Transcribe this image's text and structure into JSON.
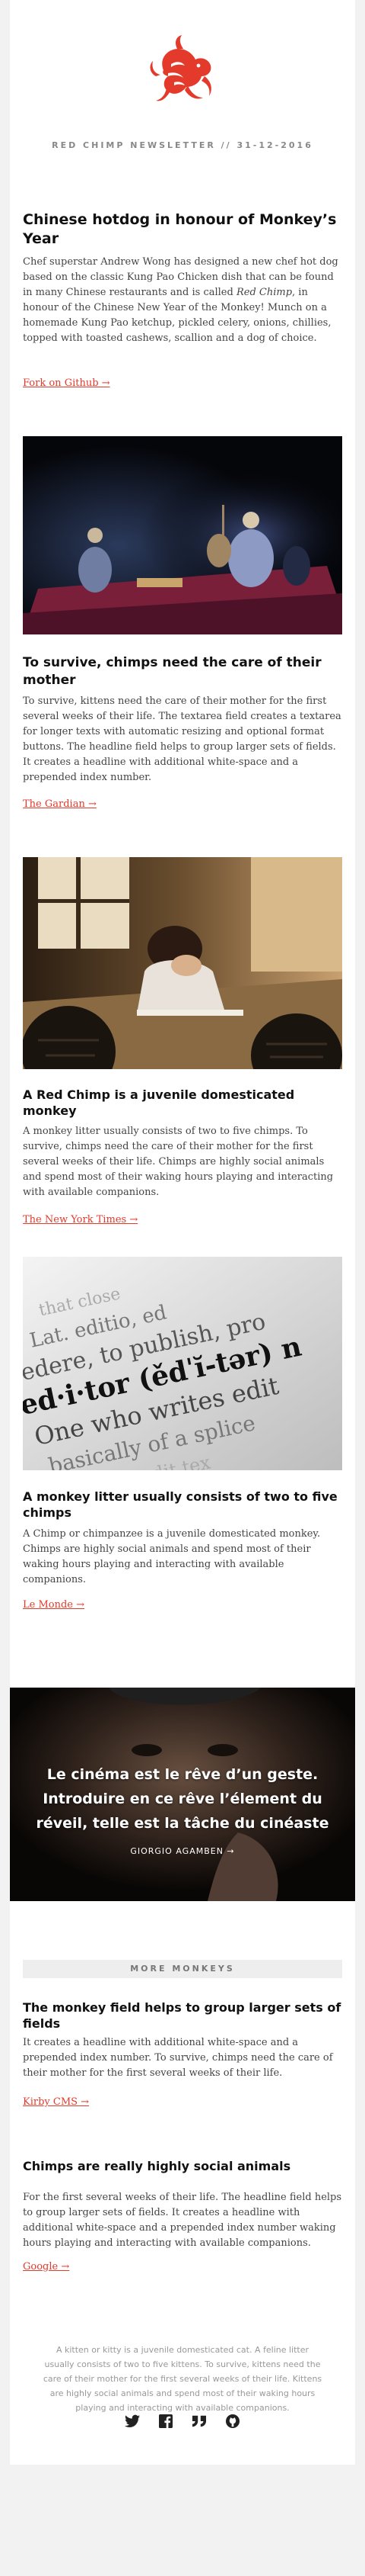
{
  "header": {
    "newsletter": "RED CHIMP NEWSLETTER // 31-12-2016"
  },
  "article1": {
    "title": "Chinese hotdog in honour of Monkey’s Year",
    "body_before": "Chef superstar Andrew Wong has designed a new chef hot dog based on the classic Kung Pao Chicken dish that can be found in many Chinese restaurants and is called ",
    "body_em": "Red Chimp",
    "body_after": ", in honour of the Chinese New Year of the Monkey! Munch on a homemade Kung Pao ketchup, pickled celery, onions, chillies, topped with toasted cashews, scallion and a dog of choice.",
    "link": "Fork on Github →"
  },
  "article2": {
    "title": "To survive, chimps need the care of their mother",
    "body": "To survive, kittens need the care of their mother for the first several weeks of their life. The textarea field creates a textarea for longer texts with automatic resizing and optional format buttons. The headline field helps to group larger sets of fields. It creates a headline with additional white-space and a prepended index number.",
    "link": "The Gardian →"
  },
  "article3": {
    "title": "A Red Chimp is a juvenile domesticated monkey",
    "body": "A monkey litter usually consists of two to five chimps. To survive, chimps need the care of their mother for the first several weeks of their life. Chimps are highly social animals and spend most of their waking hours playing and interacting with available companions.",
    "link": "The New York Times →"
  },
  "article4": {
    "image_words": [
      "that close",
      "Lat. editio, ed",
      "edere, to publish, pro",
      "ed·i·tor (ědˈĭ-tər) n",
      "One who writes edit",
      "basically of a splice",
      "used to edit tex"
    ],
    "title": "A monkey litter usually consists of two to five chimps",
    "body": "A Chimp or chimpanzee is a juvenile domesticated monkey. Chimps are highly social animals and spend most of their waking hours playing and interacting with available companions.",
    "link": "Le Monde →"
  },
  "quote": {
    "text": "Le cinéma est le rêve d’un geste. Introduire en ce rêve l’élement du réveil, telle est la tâche du cinéaste",
    "author": "GIORGIO AGAMBEN →"
  },
  "more": {
    "label": "MORE MONKEYS"
  },
  "more1": {
    "title": "The monkey field helps to group larger sets of fields",
    "body": "It creates a headline with additional white-space and a prepended index number. To survive, chimps need the care of their mother for the first several weeks of their life.",
    "link": "Kirby CMS →"
  },
  "more2": {
    "title": "Chimps are really highly social animals",
    "body": "For the first several weeks of their life. The headline field helps to group larger sets of fields. It creates a headline with additional white-space and a prepended index number waking hours playing and interacting with available companions.",
    "link": "Google →"
  },
  "footer": {
    "text": "A kitten or kitty is a juvenile domesticated cat. A feline litter usually consists of two to five kittens. To survive, kittens need the care of their mother for the first several weeks of their life. Kittens are highly social animals and spend most of their waking hours playing and interacting with available companions."
  },
  "social": [
    "twitter-icon",
    "facebook-icon",
    "quote-icon",
    "github-icon"
  ],
  "colors": {
    "accent": "#e33a2c",
    "background": "#f2f2f2",
    "card": "#ffffff"
  }
}
